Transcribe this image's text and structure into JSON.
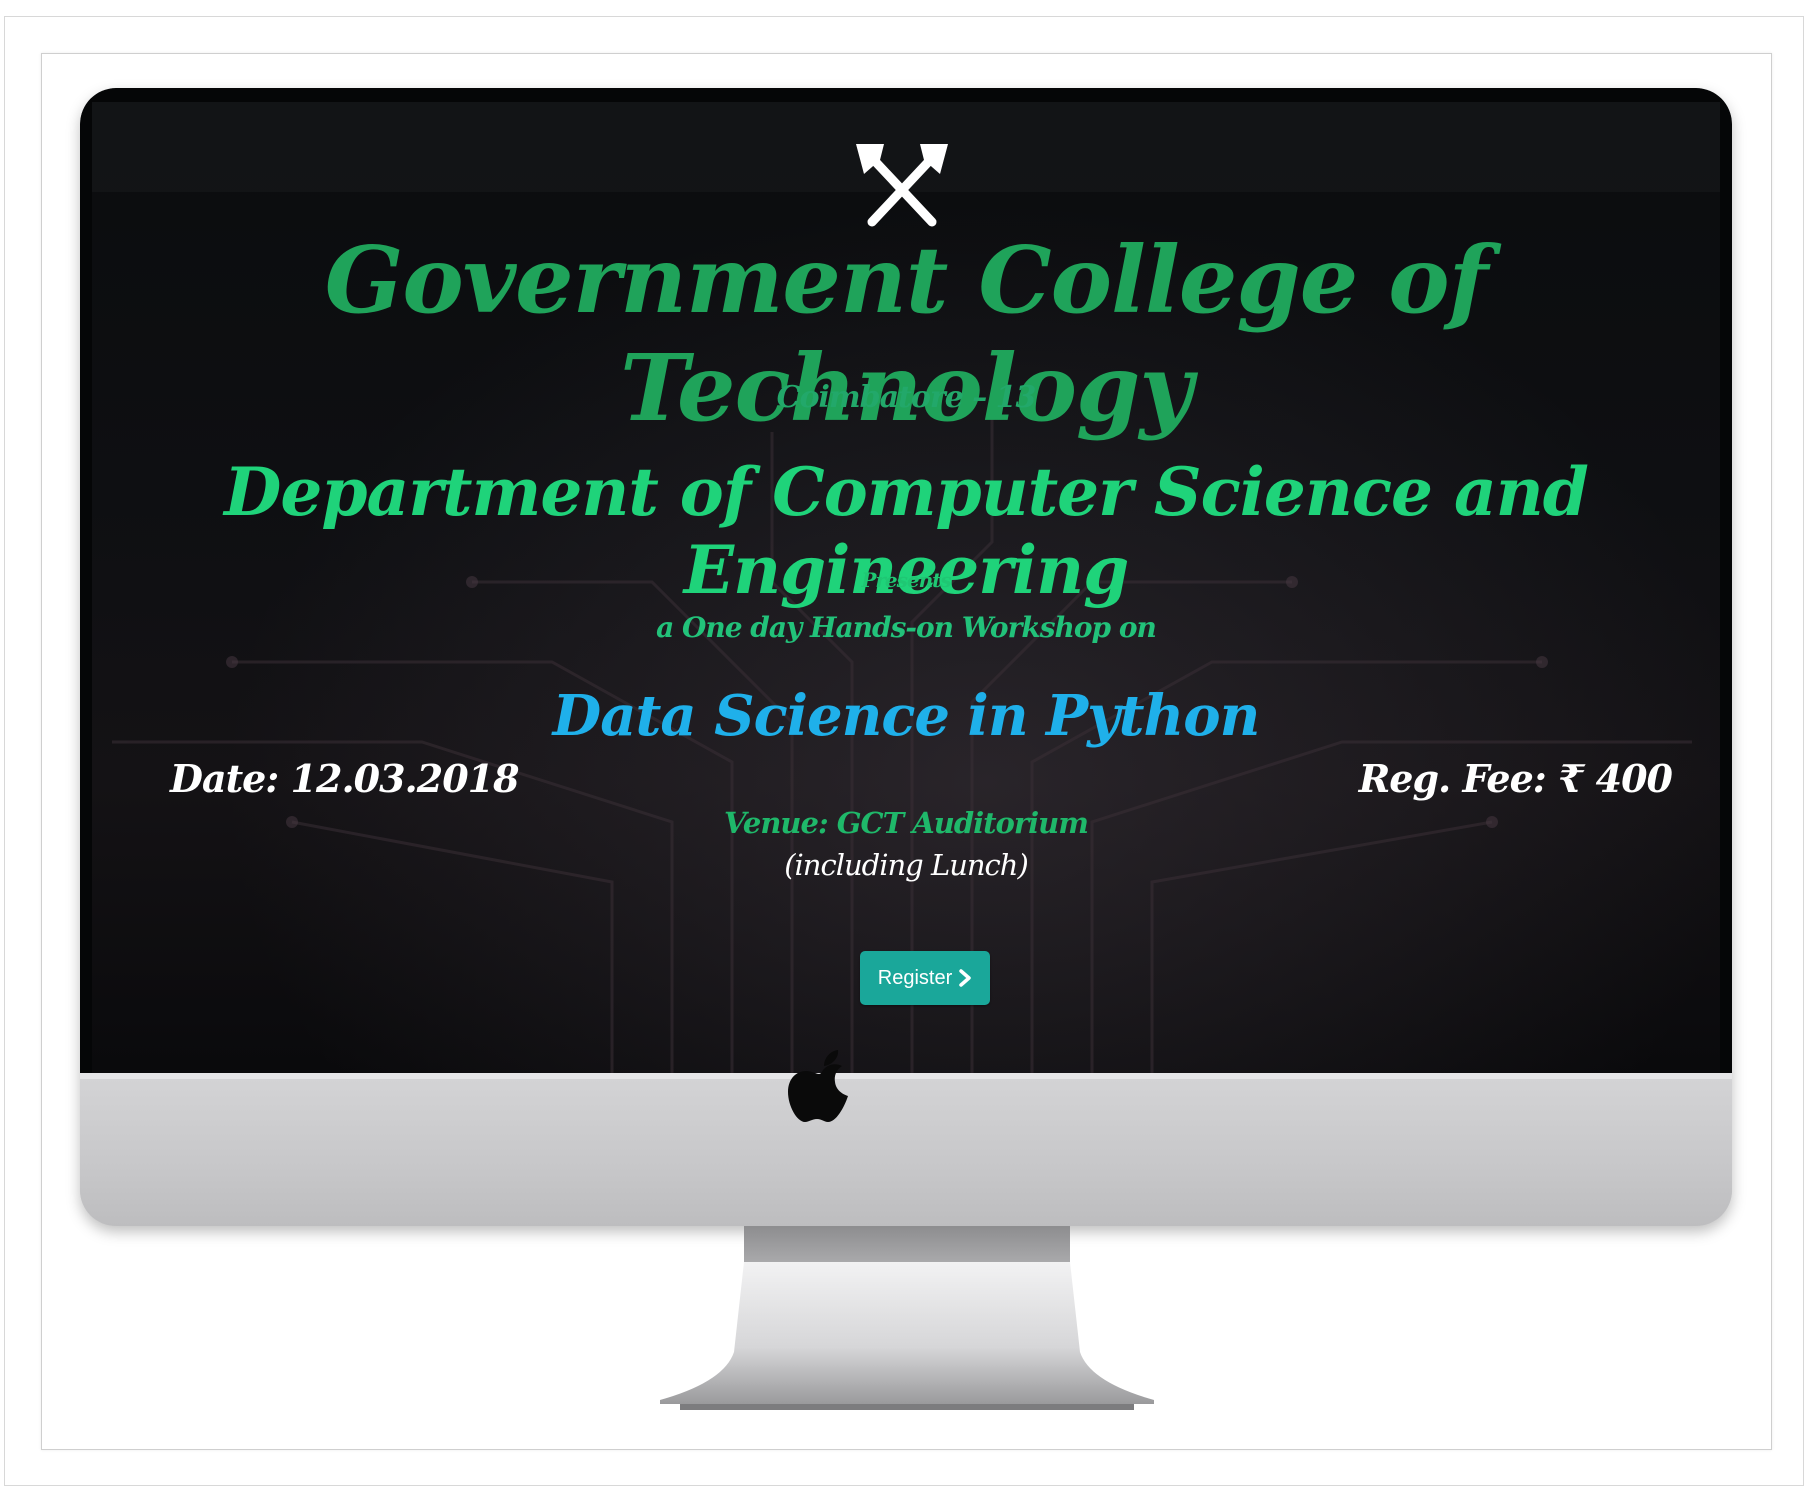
{
  "poster": {
    "college_title": "Government College of Technology",
    "city_line": "Coimbatore – 13",
    "department_title": "Department of Computer Science and Engineering",
    "presents": "Presents",
    "workshop_intro": "a One day Hands-on Workshop on",
    "workshop_title": "Data Science in Python",
    "date_text": "Date: 12.03.2018",
    "fee_text": "Reg. Fee: ₹ 400",
    "venue_text": "Venue: GCT Auditorium",
    "lunch_text": "(including Lunch)",
    "register_label": "Register"
  },
  "icons": {
    "emblem": "crossed-axes-icon",
    "register_arrow": "chevron-right-icon",
    "monitor_logo": "apple-logo-icon"
  },
  "colors": {
    "screen_bg": "#050607",
    "title_green": "#1fa35a",
    "dept_green": "#1fd37a",
    "workshop_blue": "#1fb0ea",
    "button_teal": "#1aa79a",
    "monitor_silver": "#c8c8ca"
  }
}
